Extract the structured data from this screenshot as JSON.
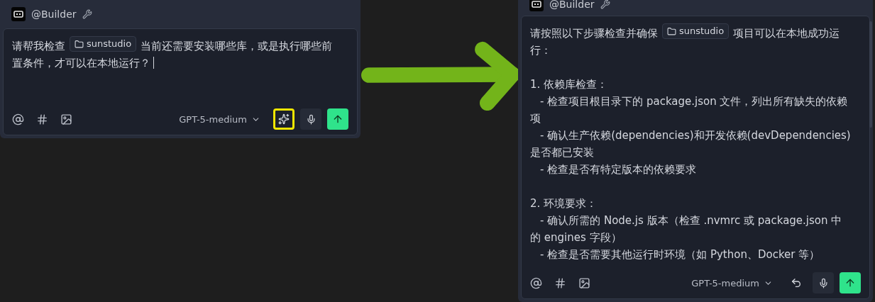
{
  "panels": [
    {
      "kind": "before",
      "header": {
        "title": "@Builder"
      },
      "message": [
        {
          "kind": "text",
          "text": "请帮我检查"
        },
        {
          "kind": "folder",
          "text": "sunstudio"
        },
        {
          "kind": "text",
          "text": "当前还需要安装哪些库，或是执行哪些前置条件，才可以在本地运行？"
        }
      ],
      "caret": true,
      "toolbar": {
        "model": "GPT-5-medium",
        "buttons": [
          {
            "kind": "enhance",
            "highlighted": true
          },
          {
            "kind": "mic",
            "highlighted": false
          },
          {
            "kind": "send",
            "highlighted": false
          }
        ]
      }
    },
    {
      "kind": "after",
      "header": {
        "title": "@Builder"
      },
      "message": [
        {
          "kind": "text",
          "text": "请按照以下步骤检查并确保"
        },
        {
          "kind": "folder",
          "text": "sunstudio"
        },
        {
          "kind": "text",
          "text": "项目可以在本地成功运行："
        }
      ],
      "caret": false,
      "sections": [
        {
          "heading": "1. 依赖库检查：",
          "items": [
            "- 检查项目根目录下的 package.json 文件，列出所有缺失的依赖项",
            "- 确认生产依赖(dependencies)和开发依赖(devDependencies)是否都已安装",
            "- 检查是否有特定版本的依赖要求"
          ]
        },
        {
          "heading": "2. 环境要求：",
          "items": [
            "- 确认所需的 Node.js 版本（检查 .nvmrc 或 package.json 中的 engines 字段）",
            "- 检查是否需要其他运行时环境（如 Python、Docker 等）"
          ]
        }
      ],
      "toolbar": {
        "model": "GPT-5-medium",
        "buttons": [
          {
            "kind": "undo",
            "highlighted": false
          },
          {
            "kind": "mic",
            "highlighted": false
          },
          {
            "kind": "send",
            "highlighted": false
          }
        ]
      }
    }
  ]
}
